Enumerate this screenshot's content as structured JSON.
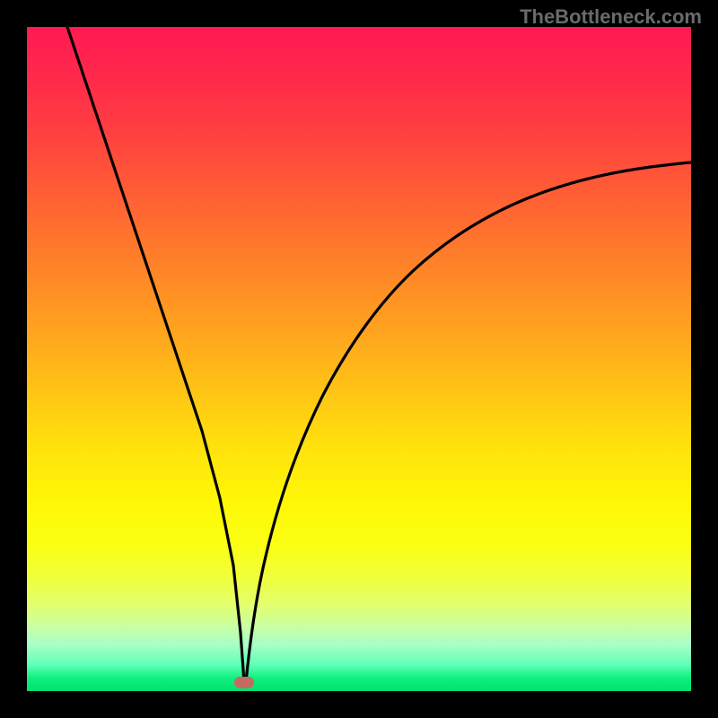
{
  "watermark": "TheBottleneck.com",
  "chart_data": {
    "type": "line",
    "title": "",
    "xlabel": "",
    "ylabel": "",
    "xlim": [
      0,
      100
    ],
    "ylim": [
      0,
      100
    ],
    "grid": false,
    "legend": false,
    "marker": {
      "x": 33,
      "y": 0,
      "color": "#c46b62"
    },
    "background_gradient": {
      "type": "vertical",
      "stops": [
        {
          "pos": 0,
          "color": "#ff1a52"
        },
        {
          "pos": 50,
          "color": "#ffab1c"
        },
        {
          "pos": 75,
          "color": "#fff806"
        },
        {
          "pos": 100,
          "color": "#00e070"
        }
      ]
    },
    "series": [
      {
        "name": "left-branch",
        "x": [
          6,
          10,
          14,
          18,
          22,
          26,
          30,
          33
        ],
        "values": [
          100,
          85,
          70,
          55,
          40,
          25,
          10,
          0
        ]
      },
      {
        "name": "right-branch",
        "x": [
          33,
          36,
          40,
          45,
          50,
          55,
          60,
          65,
          70,
          75,
          80,
          85,
          90,
          95,
          100
        ],
        "values": [
          0,
          12,
          25,
          38,
          47,
          54,
          59,
          63,
          66,
          69,
          71,
          73,
          75,
          76.5,
          78
        ]
      }
    ]
  }
}
